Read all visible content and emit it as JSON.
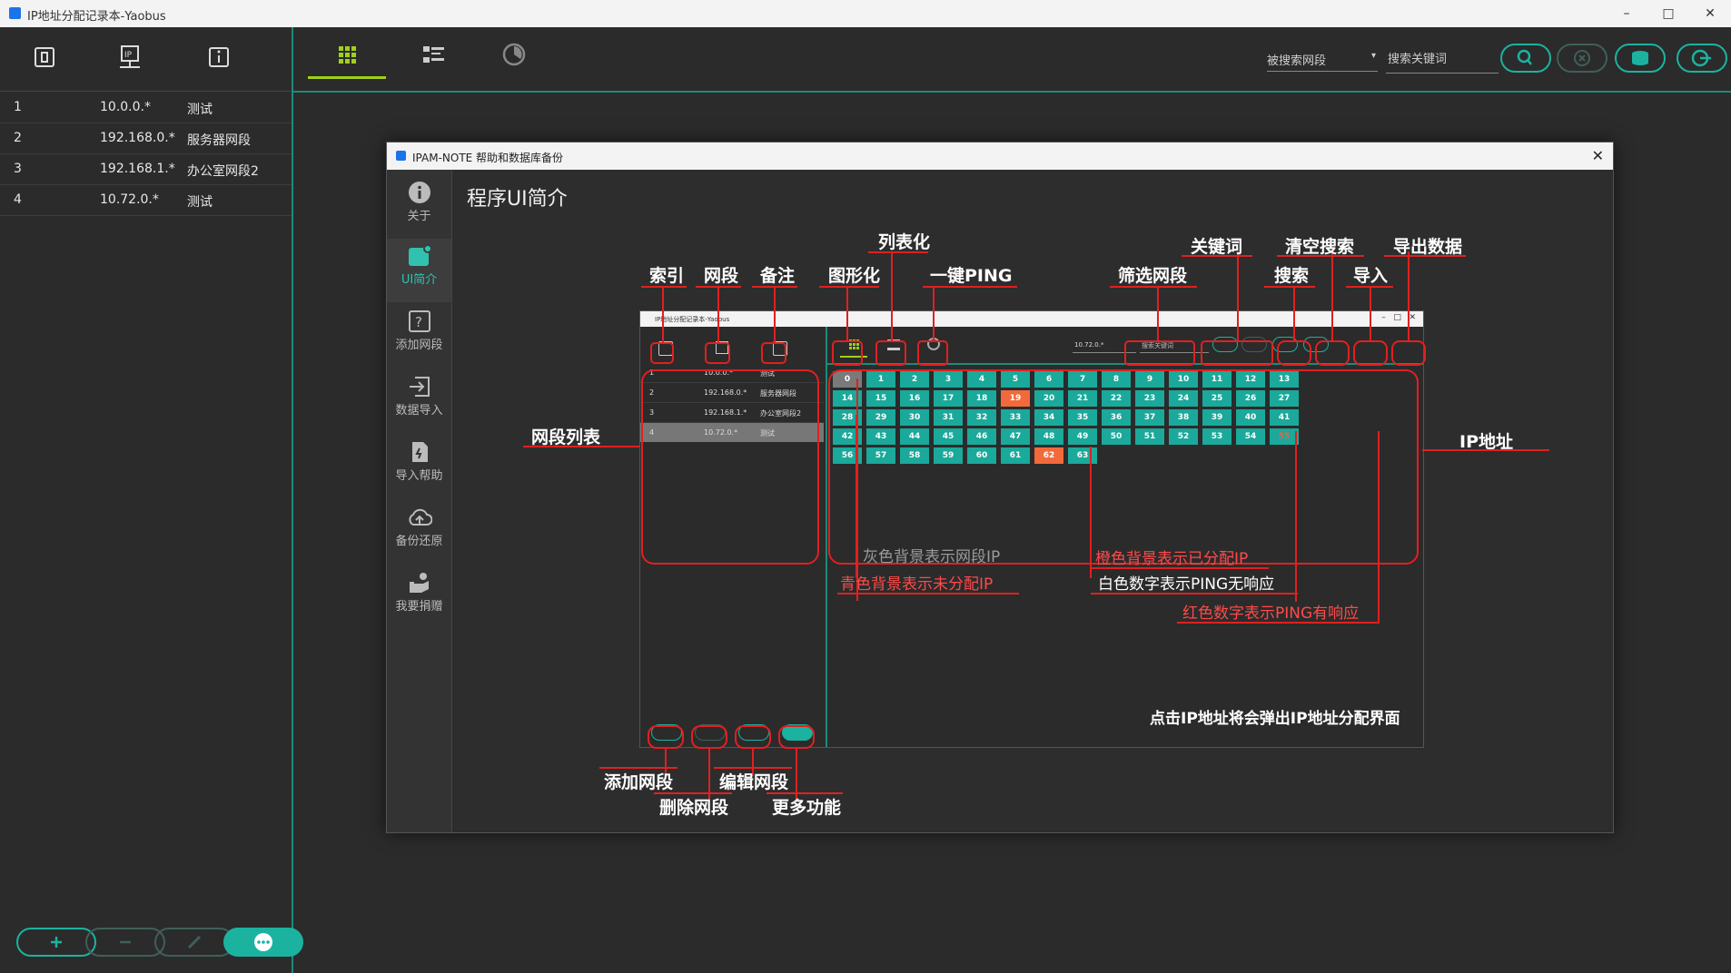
{
  "window": {
    "title": "IP地址分配记录本-Yaobus"
  },
  "left_panel": {
    "rows": [
      {
        "index": "1",
        "segment": "10.0.0.*",
        "note": "测试"
      },
      {
        "index": "2",
        "segment": "192.168.0.*",
        "note": "服务器网段"
      },
      {
        "index": "3",
        "segment": "192.168.1.*",
        "note": "办公室网段2"
      },
      {
        "index": "4",
        "segment": "10.72.0.*",
        "note": "测试"
      }
    ]
  },
  "toolbar": {
    "filter_placeholder": "被搜索网段",
    "search_placeholder": "搜索关键词"
  },
  "dialog": {
    "title": "IPAM-NOTE 帮助和数据库备份",
    "heading": "程序UI简介",
    "sidebar": [
      {
        "label": "关于"
      },
      {
        "label": "UI简介"
      },
      {
        "label": "添加网段"
      },
      {
        "label": "数据导入"
      },
      {
        "label": "导入帮助"
      },
      {
        "label": "备份还原"
      },
      {
        "label": "我要捐赠"
      }
    ],
    "annotations": {
      "index": "索引",
      "segment": "网段",
      "note": "备注",
      "graphical": "图形化",
      "listview": "列表化",
      "ping": "一键PING",
      "filter": "筛选网段",
      "keyword": "关键词",
      "clear": "清空搜索",
      "search": "搜索",
      "import": "导入",
      "export": "导出数据",
      "segment_list": "网段列表",
      "ip_address": "IP地址",
      "gray_bg": "灰色背景表示网段IP",
      "cyan_bg": "青色背景表示未分配IP",
      "orange_bg": "橙色背景表示已分配IP",
      "white_num": "白色数字表示PING无响应",
      "red_num": "红色数字表示PING有响应",
      "click_hint": "点击IP地址将会弹出IP地址分配界面",
      "add_seg": "添加网段",
      "del_seg": "删除网段",
      "edit_seg": "编辑网段",
      "more": "更多功能"
    },
    "mini": {
      "title": "IP地址分配记录本-Yaobus",
      "filter_value": "10.72.0.*",
      "search_placeholder": "搜索关键词",
      "rows": [
        {
          "index": "1",
          "segment": "10.0.0.*",
          "note": "测试"
        },
        {
          "index": "2",
          "segment": "192.168.0.*",
          "note": "服务器网段"
        },
        {
          "index": "3",
          "segment": "192.168.1.*",
          "note": "办公室网段2"
        },
        {
          "index": "4",
          "segment": "10.72.0.*",
          "note": "测试"
        }
      ],
      "ip_count": 64,
      "gray_ips": [
        0
      ],
      "orange_ips": [
        19,
        62
      ],
      "red_text_ips": [
        55
      ]
    }
  },
  "colors": {
    "accent": "#1bb3a0",
    "tile": "#1aa99a",
    "orange": "#f26a3c",
    "gray": "#7a7a7a",
    "lime": "#9fd11a",
    "annotation_red": "#e02020"
  }
}
